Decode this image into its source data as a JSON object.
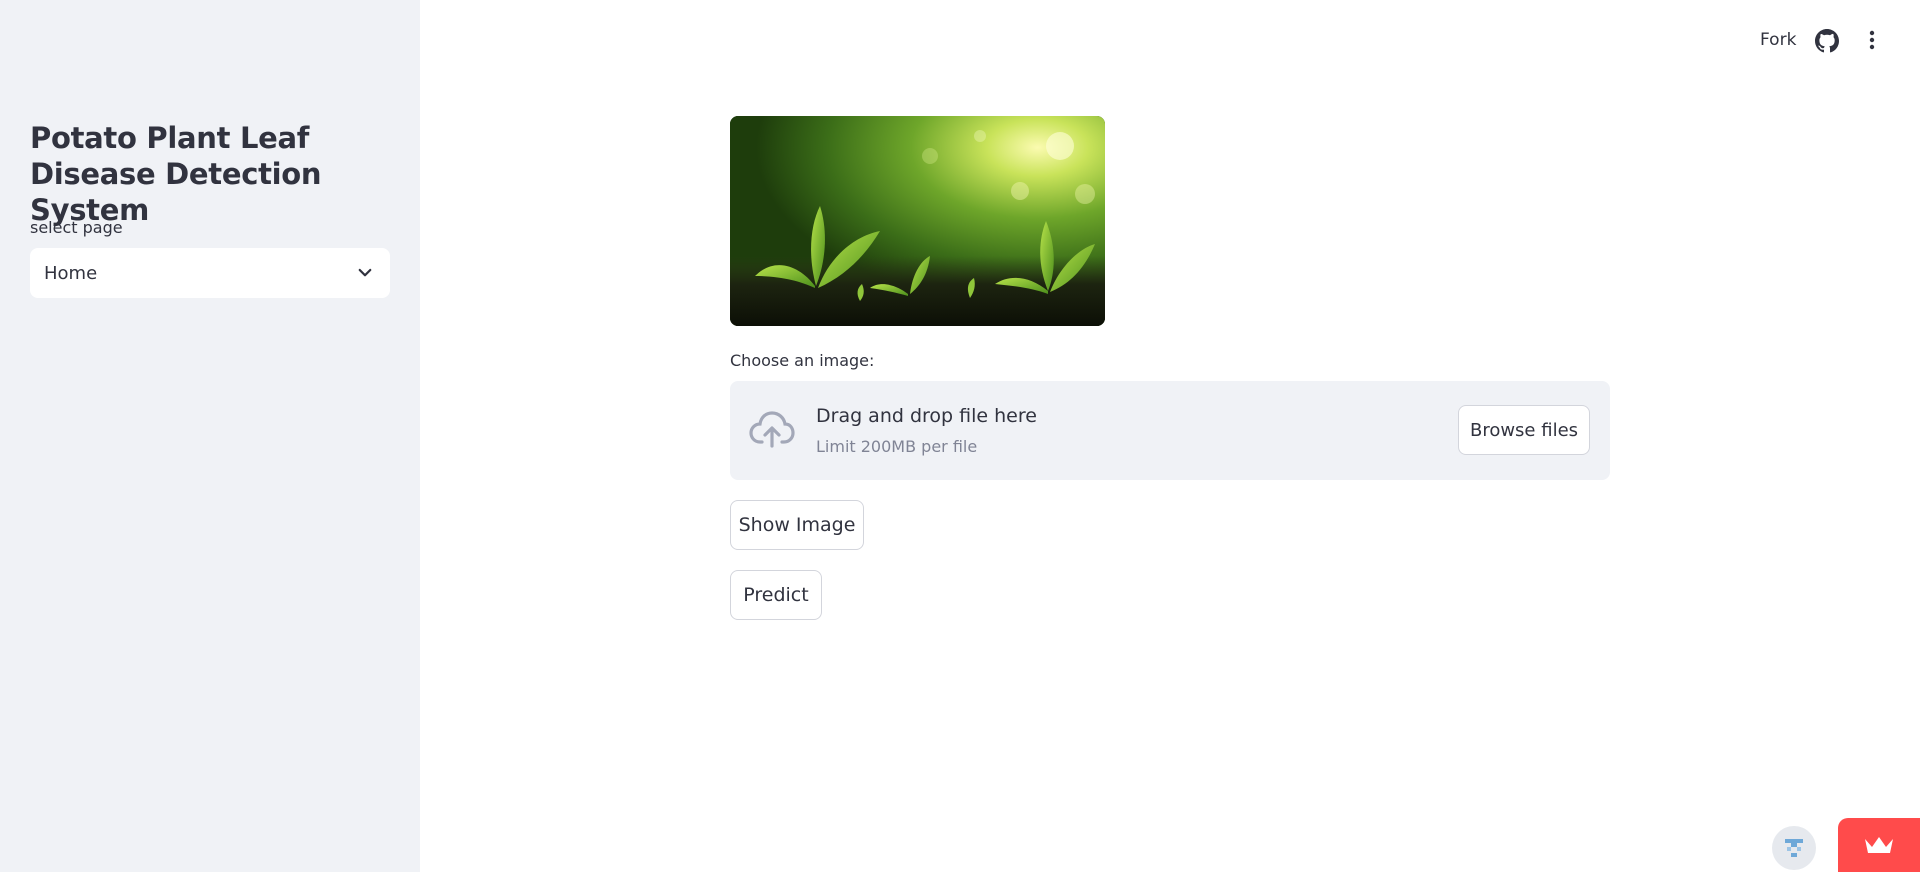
{
  "sidebar": {
    "title": "Potato Plant Leaf Disease Detection System",
    "select_label": "select page",
    "select_value": "Home"
  },
  "header": {
    "fork_label": "Fork",
    "github_icon": "github-icon",
    "menu_icon": "more-vertical-icon"
  },
  "main": {
    "banner_image": "plant-seedlings-image",
    "uploader": {
      "label": "Choose an image:",
      "dropzone_title": "Drag and drop file here",
      "dropzone_limit": "Limit 200MB per file",
      "browse_label": "Browse files",
      "icon": "cloud-upload-icon"
    },
    "show_image_label": "Show Image",
    "predict_label": "Predict"
  },
  "colors": {
    "sidebar_bg": "#f0f2f6",
    "text": "#31333f",
    "muted": "#808495",
    "accent": "#ff4b4b"
  }
}
